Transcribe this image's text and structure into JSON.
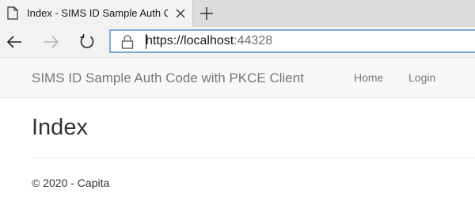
{
  "browser": {
    "tab": {
      "title": "Index - SIMS ID Sample Auth Code",
      "icon": "page-icon",
      "close_icon": "close-icon"
    },
    "new_tab_icon": "plus-icon",
    "toolbar": {
      "back_icon": "arrow-left-icon",
      "forward_icon": "arrow-right-icon",
      "refresh_icon": "refresh-icon"
    },
    "address_bar": {
      "lock_icon": "lock-icon",
      "scheme": "https://",
      "host": "localhost",
      "port": ":44328"
    }
  },
  "site": {
    "brand": "SIMS ID Sample Auth Code with PKCE Client",
    "nav": [
      {
        "label": "Home"
      },
      {
        "label": "Login"
      }
    ]
  },
  "main": {
    "heading": "Index"
  },
  "footer": {
    "text": "© 2020 - Capita"
  },
  "colors": {
    "tabstrip_bg": "#dcdcdc",
    "toolbar_bg": "#f2f2f2",
    "address_border": "#86a9d8",
    "navbar_bg": "#f8f8f8",
    "nav_text": "#777777",
    "body_text": "#333333"
  }
}
